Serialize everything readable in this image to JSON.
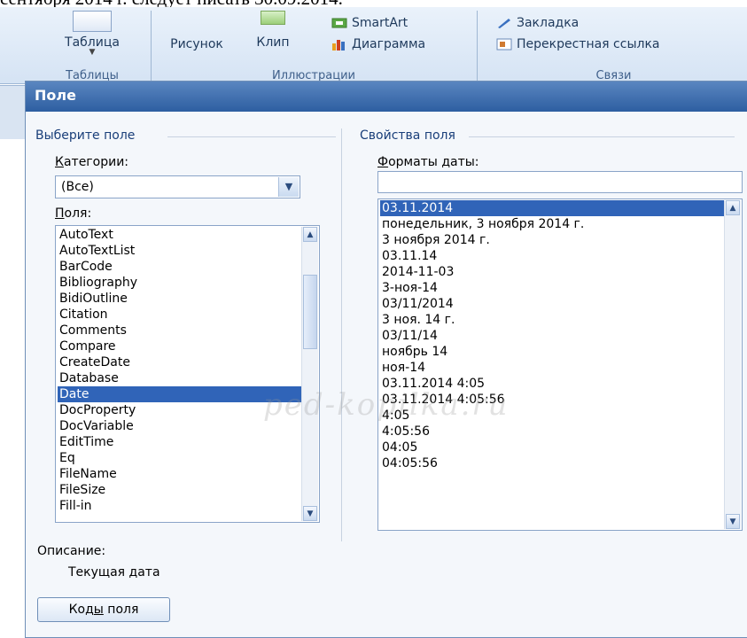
{
  "document": {
    "top_text": "сентября 2014 г. следует писать 30.09.2014."
  },
  "ribbon": {
    "tables": {
      "table_button": "Таблица",
      "group_label": "Таблицы"
    },
    "illustrations": {
      "picture_button": "Рисунок",
      "clip_button": "Клип",
      "smartart_button": "SmartArt",
      "chart_button": "Диаграмма",
      "group_label": "Иллюстрации"
    },
    "links": {
      "bookmark_button": "Закладка",
      "crossref_button": "Перекрестная ссылка",
      "group_label": "Связи"
    }
  },
  "dialog": {
    "title": "Поле",
    "left": {
      "section_label": "Выберите поле",
      "categories_label": "Категории:",
      "categories_value": "(Все)",
      "fields_label": "Поля:",
      "fields": [
        "AutoText",
        "AutoTextList",
        "BarCode",
        "Bibliography",
        "BidiOutline",
        "Citation",
        "Comments",
        "Compare",
        "CreateDate",
        "Database",
        "Date",
        "DocProperty",
        "DocVariable",
        "EditTime",
        "Eq",
        "FileName",
        "FileSize",
        "Fill-in"
      ],
      "selected_field": "Date"
    },
    "right": {
      "section_label": "Свойства поля",
      "formats_label": "Форматы даты:",
      "format_input_value": "",
      "formats": [
        "03.11.2014",
        "понедельник, 3 ноября 2014 г.",
        "3 ноября 2014 г.",
        "03.11.14",
        "2014-11-03",
        "3-ноя-14",
        "03/11/2014",
        "3 ноя. 14 г.",
        "03/11/14",
        "ноябрь 14",
        "ноя-14",
        "03.11.2014 4:05",
        "03.11.2014 4:05:56",
        "4:05",
        "4:05:56",
        "04:05",
        "04:05:56"
      ],
      "selected_format": "03.11.2014"
    },
    "description": {
      "label": "Описание:",
      "text": "Текущая дата"
    },
    "field_codes_button": "Коды поля",
    "watermark": "ped-kopilka.ru"
  }
}
